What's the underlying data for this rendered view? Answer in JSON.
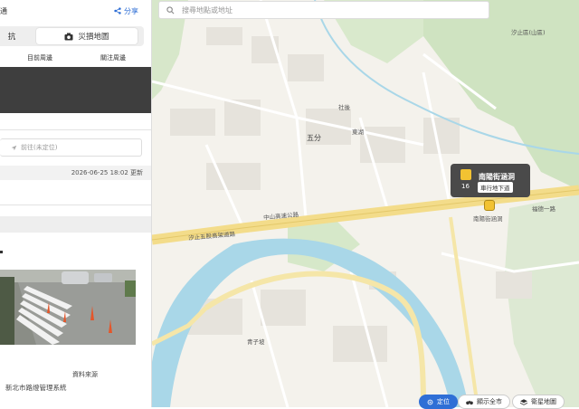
{
  "panel": {
    "title_fragment": "通",
    "share_label": "分享",
    "mode_tabs": [
      {
        "label": "抗",
        "active": false
      },
      {
        "label": "災損地圖",
        "active": true
      }
    ],
    "subtabs": [
      "目前周邊",
      "關注周邊"
    ],
    "nav_placeholder": "前往(未定位)",
    "update_text": "2026-06-25 18:02 更新",
    "source_label": "資料來源",
    "source_value": "新北市路燈管理系統"
  },
  "map": {
    "search_placeholder": "搜尋地點或地址",
    "labels": {
      "wufen": "五分",
      "donghu": "東湖",
      "qingzi": "青子坡",
      "highway": "中山高速公路",
      "xiju": "汐止五股高架道路",
      "highway_right": "中山高速公路",
      "shehou": "社後",
      "nanshang": "南陽街涵洞",
      "lingtou": "福德一路",
      "village": "汐止區(山區)",
      "marker_area": "南陽街涵洞"
    },
    "poi": {
      "name": "南陽街涵洞",
      "count": "16",
      "tag": "車行地下道"
    },
    "buttons": {
      "locate": "定位",
      "city": "顯示全市",
      "satellite": "衛星地圖"
    }
  },
  "colors": {
    "accent": "#2f6fd6",
    "poi_yellow": "#f2c232",
    "river": "#a9d7e8",
    "highway": "#f3dc8a"
  }
}
